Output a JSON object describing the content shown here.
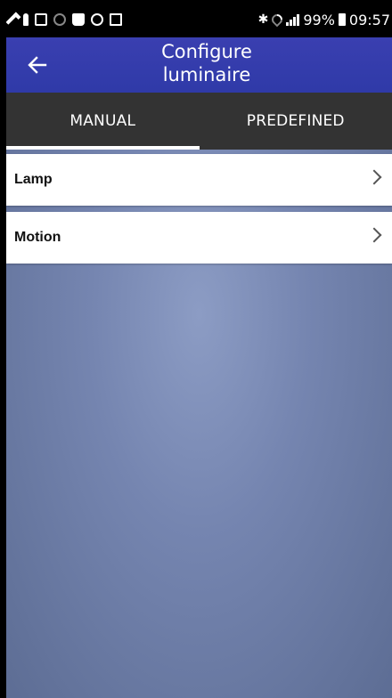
{
  "status_bar": {
    "battery": "99%",
    "time": "09:57",
    "left_icons": [
      "wrench-icon",
      "mic-icon",
      "image-icon",
      "target-icon",
      "bag-icon",
      "circle-icon",
      "screenshot-icon"
    ],
    "right_icons": [
      "bluetooth-icon",
      "wifi-icon",
      "signal-icon",
      "battery-icon"
    ]
  },
  "app_bar": {
    "title_line1": "Configure",
    "title_line2": "luminaire",
    "back_icon": "arrow-left-icon",
    "color": "#3a3fb0"
  },
  "tabs": [
    {
      "label": "MANUAL",
      "active": true
    },
    {
      "label": "PREDEFINED",
      "active": false
    }
  ],
  "list": [
    {
      "label": "Lamp"
    },
    {
      "label": "Motion"
    }
  ]
}
